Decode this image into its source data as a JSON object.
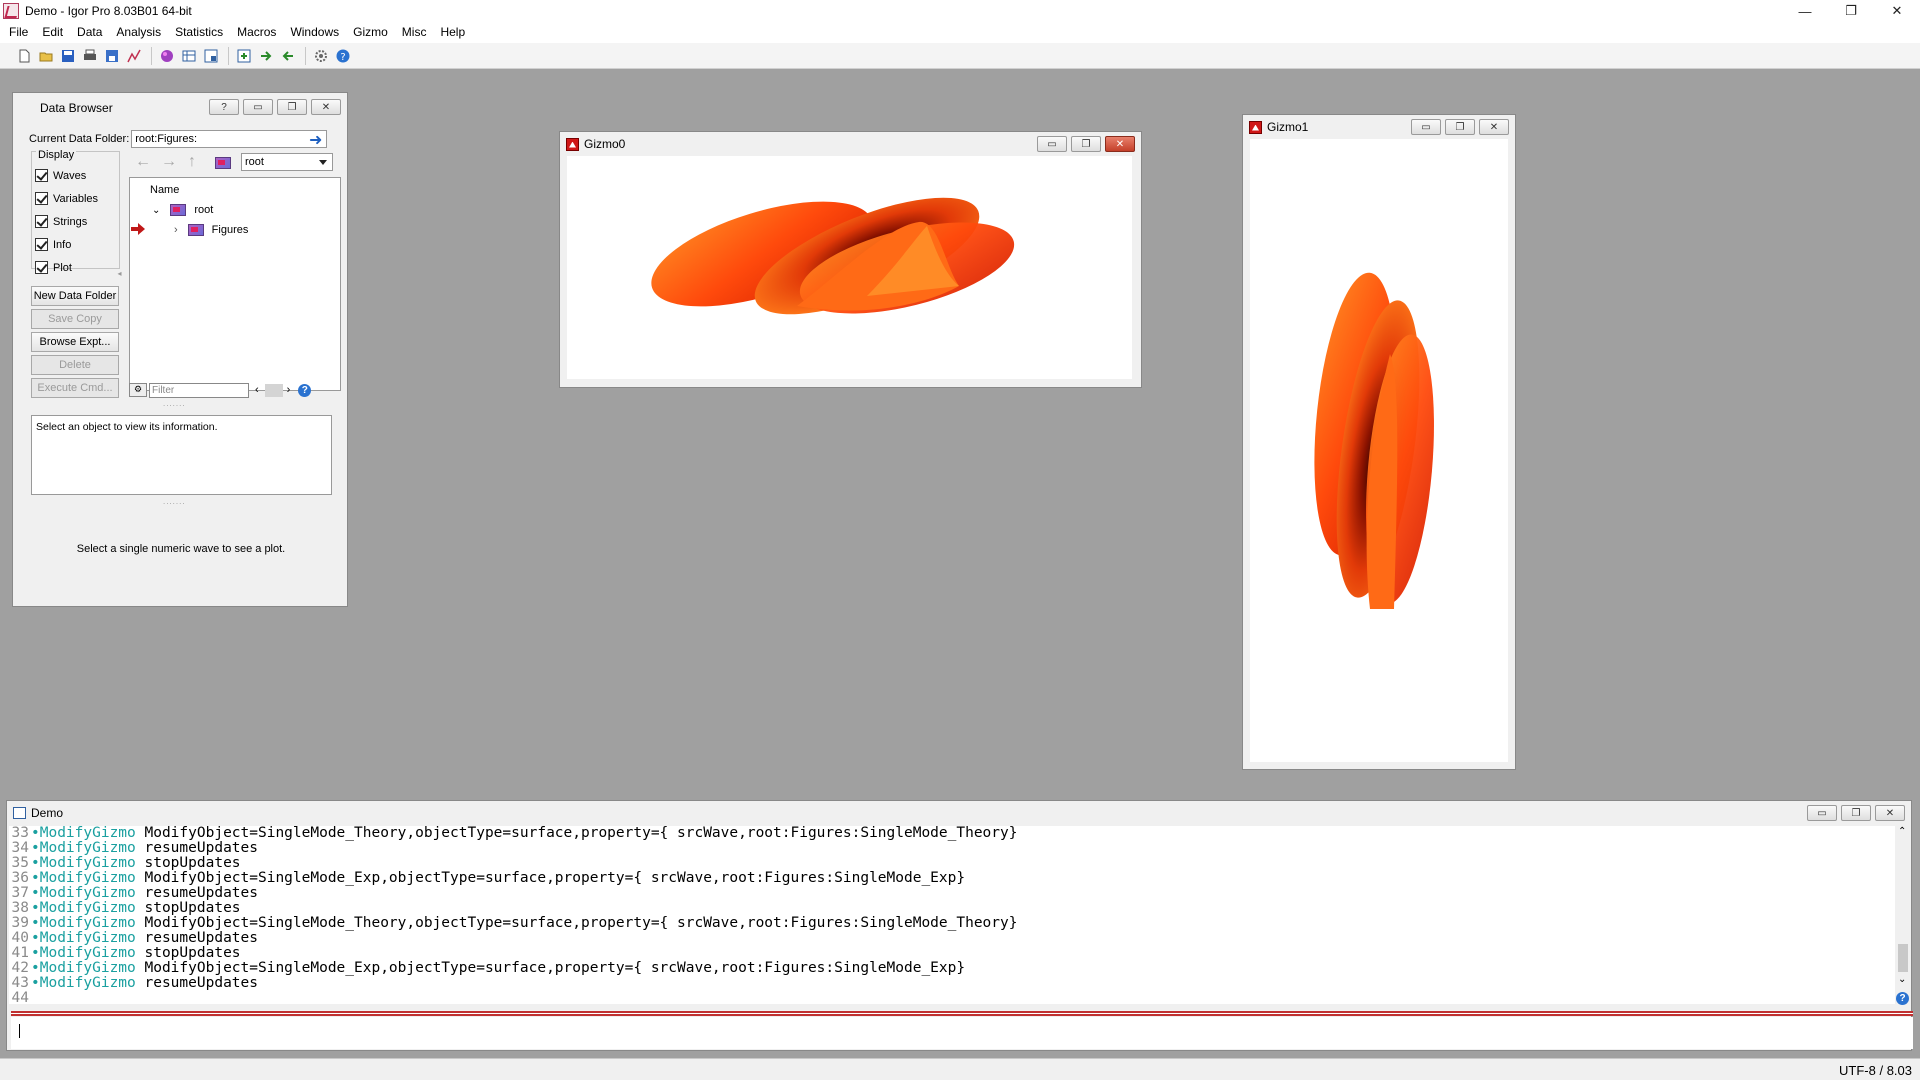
{
  "app": {
    "title": "Demo - Igor Pro 8.03B01 64-bit",
    "controls": [
      "—",
      "❐",
      "✕"
    ]
  },
  "menu": [
    "File",
    "Edit",
    "Data",
    "Analysis",
    "Statistics",
    "Macros",
    "Windows",
    "Gizmo",
    "Misc",
    "Help"
  ],
  "toolbar_icons": [
    "new-icon",
    "open-icon",
    "save-icon",
    "print-icon",
    "save-copy-icon",
    "graph-icon",
    "gizmo-icon",
    "table-icon",
    "layout-icon",
    "load-icon",
    "export-icon",
    "import-icon",
    "settings-icon",
    "help-icon"
  ],
  "data_browser": {
    "title": "Data Browser",
    "ctrl_help": "?",
    "current_folder_label": "Current Data Folder:",
    "current_folder": "root:Figures:",
    "display_label": "Display",
    "checkboxes": [
      "Waves",
      "Variables",
      "Strings",
      "Info",
      "Plot"
    ],
    "buttons": [
      "New Data Folder",
      "Save Copy",
      "Browse Expt...",
      "Delete",
      "Execute Cmd..."
    ],
    "folder_select": "root",
    "name_header": "Name",
    "tree": [
      "root",
      "Figures"
    ],
    "filter_placeholder": "Filter",
    "info_text": "Select an object to view its information.",
    "plot_text": "Select a single numeric wave to see a plot."
  },
  "gizmo0": {
    "title": "Gizmo0"
  },
  "gizmo1": {
    "title": "Gizmo1"
  },
  "command_window": {
    "title": "Demo",
    "lines": [
      {
        "n": "33",
        "kw": "•ModifyGizmo",
        "rest": " ModifyObject=SingleMode_Theory,objectType=surface,property={ srcWave,root:Figures:SingleMode_Theory}"
      },
      {
        "n": "34",
        "kw": "•ModifyGizmo",
        "rest": " resumeUpdates"
      },
      {
        "n": "35",
        "kw": "•ModifyGizmo",
        "rest": " stopUpdates"
      },
      {
        "n": "36",
        "kw": "•ModifyGizmo",
        "rest": " ModifyObject=SingleMode_Exp,objectType=surface,property={ srcWave,root:Figures:SingleMode_Exp}"
      },
      {
        "n": "37",
        "kw": "•ModifyGizmo",
        "rest": " resumeUpdates"
      },
      {
        "n": "38",
        "kw": "•ModifyGizmo",
        "rest": " stopUpdates"
      },
      {
        "n": "39",
        "kw": "•ModifyGizmo",
        "rest": " ModifyObject=SingleMode_Theory,objectType=surface,property={ srcWave,root:Figures:SingleMode_Theory}"
      },
      {
        "n": "40",
        "kw": "•ModifyGizmo",
        "rest": " resumeUpdates"
      },
      {
        "n": "41",
        "kw": "•ModifyGizmo",
        "rest": " stopUpdates"
      },
      {
        "n": "42",
        "kw": "•ModifyGizmo",
        "rest": " ModifyObject=SingleMode_Exp,objectType=surface,property={ srcWave,root:Figures:SingleMode_Exp}"
      },
      {
        "n": "43",
        "kw": "•ModifyGizmo",
        "rest": " resumeUpdates"
      },
      {
        "n": "44",
        "kw": "",
        "rest": ""
      }
    ]
  },
  "status": {
    "encoding": "UTF-8 / 8.03"
  },
  "colors": {
    "accent": "#1d5fc0",
    "surface_hot": "#ff3a0a",
    "surface_dark": "#3a0500",
    "command_keyword": "#1aa0a0",
    "divider": "#c03030"
  }
}
